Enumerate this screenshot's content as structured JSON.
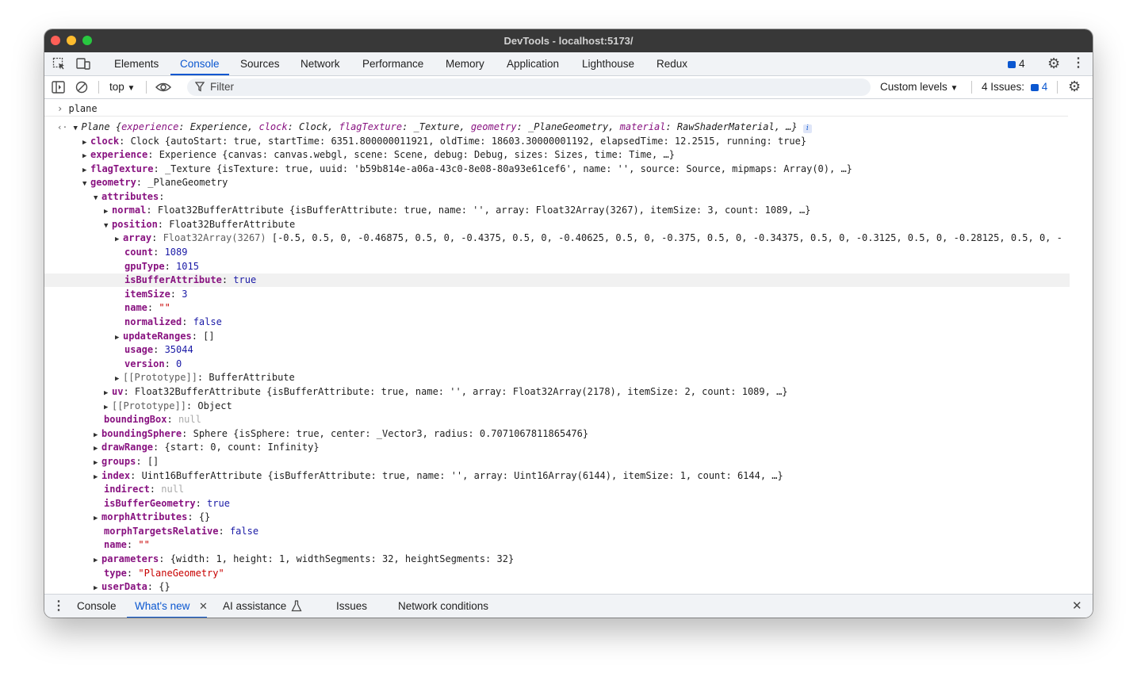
{
  "window": {
    "title": "DevTools - localhost:5173/"
  },
  "tabs": [
    "Elements",
    "Console",
    "Sources",
    "Network",
    "Performance",
    "Memory",
    "Application",
    "Lighthouse",
    "Redux"
  ],
  "header_badge_count": "4",
  "toolbar": {
    "context": "top",
    "filter_placeholder": "Filter",
    "levels": "Custom levels",
    "issues_label": "4 Issues:",
    "issues_count": "4"
  },
  "console": {
    "input_command": "plane",
    "object_name": "Plane",
    "object_preview_tail": "…}",
    "clock_label": "clock",
    "clock_value": "Clock {autoStart: true, startTime: 6351.800000011921, oldTime: 18603.30000001192, elapsedTime: 12.2515, running: true}",
    "experience_label": "experience",
    "experience_value": "Experience {canvas: canvas.webgl, scene: Scene, debug: Debug, sizes: Sizes, time: Time, …}",
    "flagTexture_label": "flagTexture",
    "flagTexture_value": "_Texture {isTexture: true, uuid: 'b59b814e-a06a-43c0-8e08-80a93e61cef6', name: '', source: Source, mipmaps: Array(0), …}",
    "geometry_label": "geometry",
    "geometry_value": "_PlaneGeometry",
    "attributes_label": "attributes",
    "normal_label": "normal",
    "normal_value": "Float32BufferAttribute {isBufferAttribute: true, name: '', array: Float32Array(3267), itemSize: 3, count: 1089, …}",
    "position_label": "position",
    "position_value": "Float32BufferAttribute",
    "array_label": "array",
    "array_type": "Float32Array(3267)",
    "array_values": "[-0.5, 0.5, 0, -0.46875, 0.5, 0, -0.4375, 0.5, 0, -0.40625, 0.5, 0, -0.375, 0.5, 0, -0.34375, 0.5, 0, -0.3125, 0.5, 0, -0.28125, 0.5, 0, -",
    "count_label": "count",
    "count_value": "1089",
    "gpuType_label": "gpuType",
    "gpuType_value": "1015",
    "isBufferAttribute_label": "isBufferAttribute",
    "isBufferAttribute_value": "true",
    "itemSize_label": "itemSize",
    "itemSize_value": "3",
    "name_label": "name",
    "name_value": "\"\"",
    "normalized_label": "normalized",
    "normalized_value": "false",
    "updateRanges_label": "updateRanges",
    "updateRanges_value": "[]",
    "usage_label": "usage",
    "usage_value": "35044",
    "version_label": "version",
    "version_value": "0",
    "proto1_label": "[[Prototype]]",
    "proto1_value": "BufferAttribute",
    "uv_label": "uv",
    "uv_value": "Float32BufferAttribute {isBufferAttribute: true, name: '', array: Float32Array(2178), itemSize: 2, count: 1089, …}",
    "proto2_label": "[[Prototype]]",
    "proto2_value": "Object",
    "boundingBox_label": "boundingBox",
    "boundingBox_value": "null",
    "boundingSphere_label": "boundingSphere",
    "boundingSphere_value": "Sphere {isSphere: true, center: _Vector3, radius: 0.7071067811865476}",
    "drawRange_label": "drawRange",
    "drawRange_value": "{start: 0, count: Infinity}",
    "groups_label": "groups",
    "groups_value": "[]",
    "index_label": "index",
    "index_value": "Uint16BufferAttribute {isBufferAttribute: true, name: '', array: Uint16Array(6144), itemSize: 1, count: 6144, …}",
    "indirect_label": "indirect",
    "indirect_value": "null",
    "isBufferGeometry_label": "isBufferGeometry",
    "isBufferGeometry_value": "true",
    "morphAttributes_label": "morphAttributes",
    "morphAttributes_value": "{}",
    "morphTargetsRelative_label": "morphTargetsRelative",
    "morphTargetsRelative_value": "false",
    "geoname_label": "name",
    "geoname_value": "\"\"",
    "parameters_label": "parameters",
    "parameters_value": "{width: 1, height: 1, widthSegments: 32, heightSegments: 32}",
    "type_label": "type",
    "type_value": "\"PlaneGeometry\"",
    "userData_label": "userData",
    "userData_value": "{}"
  },
  "drawer_tabs": [
    "Console",
    "What's new",
    "AI assistance",
    "Issues",
    "Network conditions"
  ],
  "icons": [
    "inspect-icon",
    "device-toggle-icon",
    "issues-badge-icon",
    "settings-gear-icon",
    "more-vert-icon",
    "sidebar-toggle-icon",
    "clear-console-icon",
    "eye-icon",
    "filter-funnel-icon",
    "info-icon",
    "flask-icon",
    "close-icon"
  ],
  "colors": {
    "accent": "#0b57d0",
    "key": "#881280",
    "string": "#c80000",
    "number": "#1a1aa6"
  }
}
